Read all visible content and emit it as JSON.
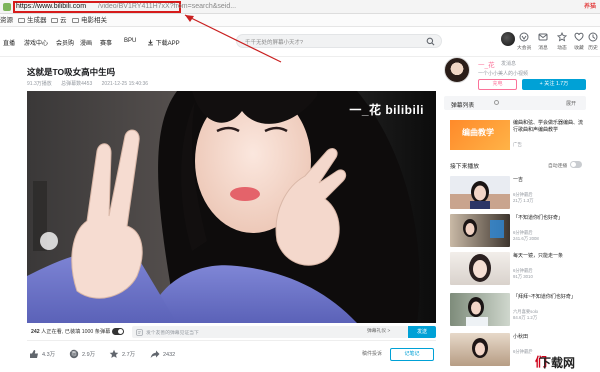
{
  "browser": {
    "url_host": "https://www.bilibili.com",
    "url_path": "/video/BV1RY411H7xX?from=search&seid...",
    "right_text": "养猫",
    "bookmarks": [
      "资源",
      "生成器",
      "云",
      "电影相关"
    ]
  },
  "header": {
    "nav": [
      "直播",
      "游戏中心",
      "会员购",
      "漫画",
      "赛事",
      "BPU",
      "下载APP"
    ],
    "search_placeholder": "千千无处的屏幕小天才?",
    "icons": [
      {
        "name": "big-member-icon",
        "label": "大会员"
      },
      {
        "name": "message-icon",
        "label": "消息"
      },
      {
        "name": "dynamic-icon",
        "label": "动态"
      },
      {
        "name": "favorite-icon",
        "label": "收藏"
      },
      {
        "name": "history-icon",
        "label": "历史"
      }
    ]
  },
  "video": {
    "title": "这就是TO吸女高中生吗",
    "meta": [
      "91.3万播放",
      "总弹幕数4453",
      "2021-12-25 15:40:36"
    ],
    "watermark": "一_花 bilibili",
    "viewers_count": "242",
    "viewers_text": "人正在看",
    "danmaku_loaded": "已装填 1000 条弹幕",
    "danmaku_placeholder": "发个友善的弹幕见证当下",
    "danmaku_etiquette": "弹幕礼仪 >",
    "send_label": "发送",
    "actions": [
      {
        "name": "like",
        "value": "4.3万"
      },
      {
        "name": "coin",
        "value": "2.9万"
      },
      {
        "name": "collect",
        "value": "2.7万"
      },
      {
        "name": "share",
        "value": "2432"
      }
    ],
    "report_label": "稿件投诉",
    "notes_label": "记笔记"
  },
  "uploader": {
    "name": "一_花",
    "msg_label": "发消息",
    "desc": "一个小小美人的小视频",
    "charge_label": "充电",
    "follow_label": "+ 关注 1.7万"
  },
  "sidebar": {
    "danmaku_list_label": "弹幕列表",
    "danmaku_list_more": "展开",
    "ad": {
      "thumb_text": "编曲教学",
      "text": "编曲和弦、学会做乐器编曲、流行歌曲和声编曲教学",
      "tag": "广告"
    },
    "next_label": "接下来播放",
    "autoplay_label": "自动连播",
    "recommendations": [
      {
        "title": "一吉",
        "up": "6分钟最后",
        "stats": "21万  1.3万"
      },
      {
        "title": "「不知道你们也好奇」",
        "up": "6分钟最后",
        "stats": "241.6万  2008"
      },
      {
        "title": "每天一镜，只能走一条",
        "up": "6分钟最后",
        "stats": "91万  3010"
      },
      {
        "title": "「拜拜~不知道你们也好奇」",
        "up": "六月喜要solo",
        "stats": "84.6万  1.2万"
      },
      {
        "title": "小秋田",
        "up": "6分钟最后",
        "stats": ""
      },
      {
        "title": "我吃下...",
        "up": "6分钟最后",
        "stats": ""
      }
    ]
  },
  "brand": {
    "text_main": "们",
    "text_rest": "下载网"
  }
}
